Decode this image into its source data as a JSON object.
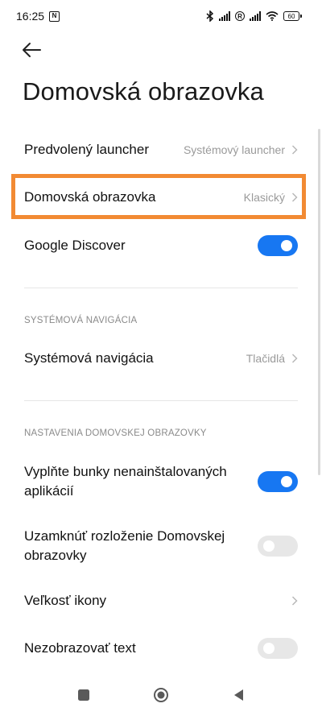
{
  "status_bar": {
    "time": "16:25",
    "battery": "60",
    "icons": [
      "nfc-icon",
      "bluetooth-icon",
      "signal-icon",
      "roaming-icon",
      "signal-icon",
      "wifi-icon",
      "battery-icon"
    ]
  },
  "header": {
    "back_icon": "arrow-left-icon",
    "title": "Domovská obrazovka"
  },
  "items": {
    "launcher": {
      "label": "Predvolený launcher",
      "value": "Systémový launcher"
    },
    "home_screen": {
      "label": "Domovská obrazovka",
      "value": "Klasický"
    },
    "google_discover": {
      "label": "Google Discover",
      "toggle": true
    }
  },
  "sections": {
    "system_nav": {
      "header": "SYSTÉMOVÁ NAVIGÁCIA",
      "item": {
        "label": "Systémová navigácia",
        "value": "Tlačidlá"
      }
    },
    "home_settings": {
      "header": "NASTAVENIA DOMOVSKEJ OBRAZOVKY",
      "fill_cells": {
        "label_line1": "Vyplňte bunky nenainštalovaných",
        "label_line2": "aplikácií",
        "toggle": true
      },
      "lock_layout": {
        "label_line1": "Uzamknúť rozloženie Domovskej",
        "label_line2": "obrazovky",
        "toggle": false
      },
      "icon_size": {
        "label": "Veľkosť ikony"
      },
      "hide_text": {
        "label": "Nezobrazovať text",
        "toggle": false
      }
    }
  },
  "colors": {
    "accent": "#1777f2",
    "highlight": "#f28a33",
    "toggle_off": "#e7e7e7"
  },
  "nav_bar": {
    "icons": [
      "square-icon",
      "circle-icon",
      "triangle-back-icon"
    ]
  }
}
